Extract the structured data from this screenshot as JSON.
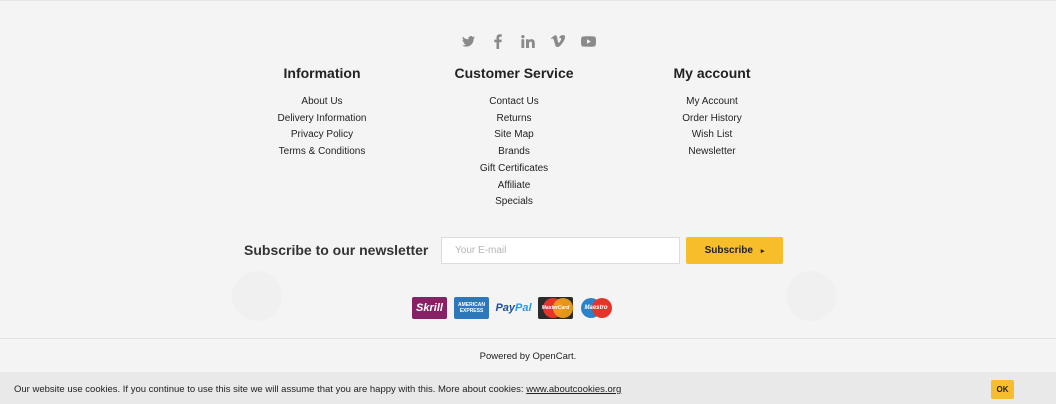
{
  "social": [
    {
      "name": "twitter-icon"
    },
    {
      "name": "facebook-icon"
    },
    {
      "name": "linkedin-icon"
    },
    {
      "name": "vimeo-icon"
    },
    {
      "name": "youtube-icon"
    }
  ],
  "information": {
    "title": "Information",
    "items": [
      "About Us",
      "Delivery Information",
      "Privacy Policy",
      "Terms & Conditions"
    ]
  },
  "customer_service": {
    "title": "Customer Service",
    "items": [
      "Contact Us",
      "Returns",
      "Site Map",
      "Brands",
      "Gift Certificates",
      "Affiliate",
      "Specials"
    ]
  },
  "my_account": {
    "title": "My account",
    "items": [
      "My Account",
      "Order History",
      "Wish List",
      "Newsletter"
    ]
  },
  "newsletter": {
    "title": "Subscribe to our newsletter",
    "placeholder": "Your E-mail",
    "value": "",
    "button_label": "Subscribe",
    "button_arrow": "▸"
  },
  "payments": {
    "skrill": "Skrill",
    "amex_line1": "AMERICAN",
    "amex_line2": "EXPRESS",
    "paypal_pay": "Pay",
    "paypal_pal": "Pal",
    "mastercard": "MasterCard",
    "maestro": "Maestro"
  },
  "footer": {
    "powered": "Powered by OpenCart."
  },
  "cookie": {
    "text": "Our website use cookies. If you continue to use this site we will assume that you are happy with this. More about cookies: ",
    "link": "www.aboutcookies.org",
    "ok": "OK"
  },
  "colors": {
    "accent": "#f6be2b",
    "background": "#f4f4f4",
    "icon": "#8a8a8a"
  }
}
